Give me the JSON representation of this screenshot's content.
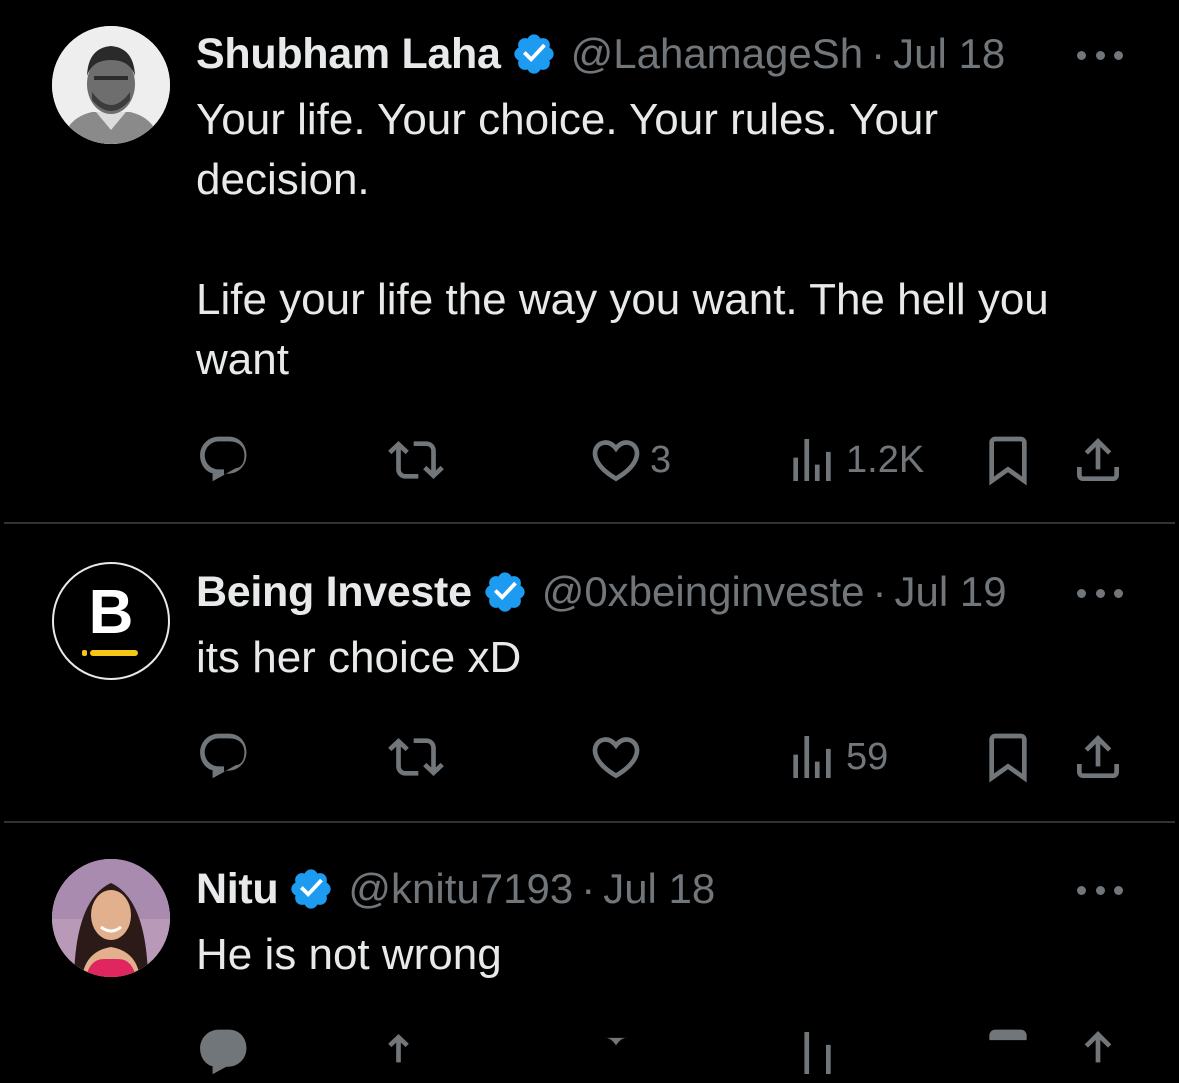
{
  "tweets": [
    {
      "display_name": "Shubham Laha",
      "handle": "@LahamageSh",
      "separator": "·",
      "date": "Jul 18",
      "text": "Your life. Your choice. Your rules. Your decision.\n\nLife your life the way you want. The hell you want",
      "likes": "3",
      "views": "1.2K",
      "avatar": "user-photo"
    },
    {
      "display_name": "Being Investe",
      "handle": "@0xbeinginveste",
      "separator": "·",
      "date": "Jul 19",
      "text": "its her choice xD",
      "likes": "",
      "views": "59",
      "avatar": "logo-B",
      "avatar_letter": "B"
    },
    {
      "display_name": "Nitu",
      "handle": "@knitu7193",
      "separator": "·",
      "date": "Jul 18",
      "text": "He is not wrong",
      "likes": "",
      "views": "",
      "avatar": "user-photo"
    }
  ],
  "colors": {
    "background": "#000000",
    "text_primary": "#e7e9ea",
    "text_secondary": "#71767b",
    "verified_blue": "#1d9bf0",
    "divider": "#2f3336",
    "logo_accent": "#f5c518"
  },
  "icons": [
    "reply-icon",
    "repost-icon",
    "like-icon",
    "views-icon",
    "bookmark-icon",
    "share-icon",
    "more-icon",
    "verified-badge-icon"
  ]
}
